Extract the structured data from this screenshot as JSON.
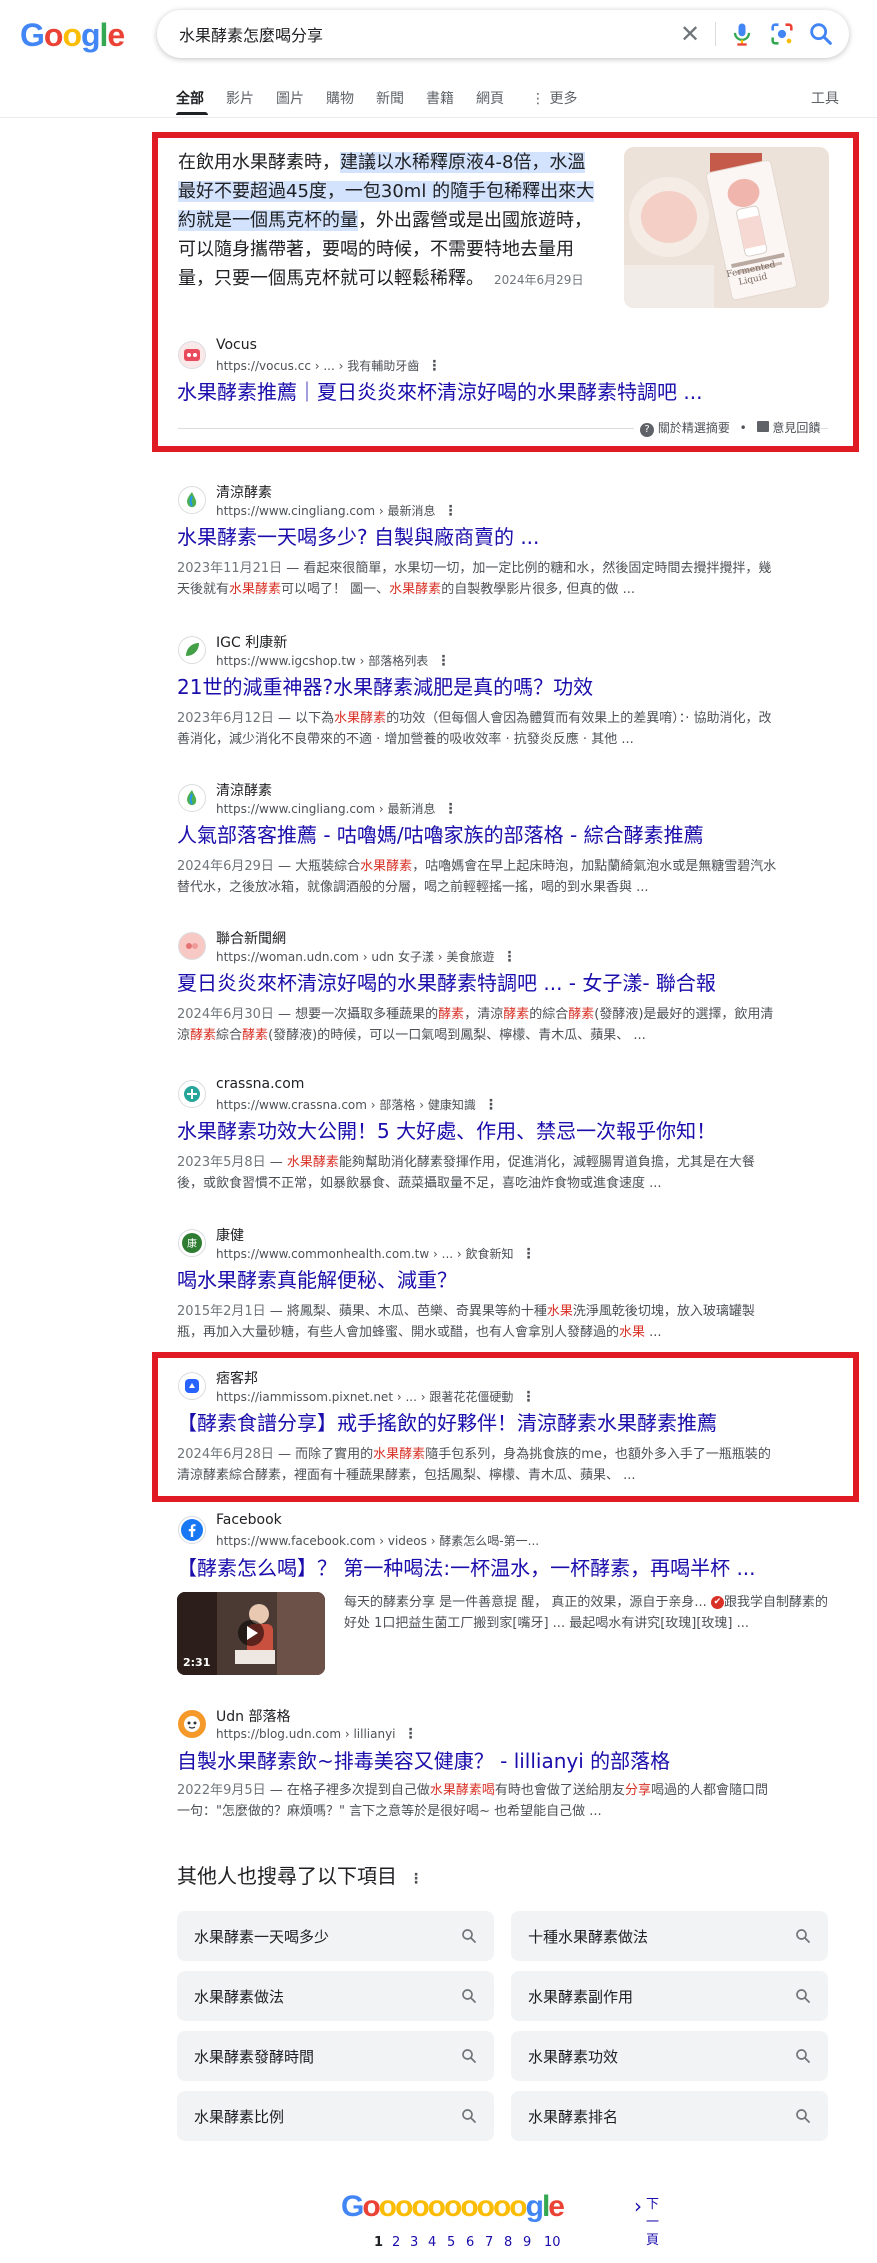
{
  "logo_text": "Google",
  "search": {
    "query": "水果酵素怎麼喝分享"
  },
  "tabs": [
    "全部",
    "影片",
    "圖片",
    "購物",
    "新聞",
    "書籍",
    "網頁",
    "更多"
  ],
  "tools_label": "工具",
  "featured": {
    "text_plain_1": "在飲用水果酵素時，",
    "text_hl": "建議以水稀釋原液4-8倍，水溫最好不要超過45度，一包30ml 的隨手包稀釋出來大約就是一個馬克杯的量",
    "text_plain_2": "，外出露營或是出國旅遊時，可以隨身攜帶著，要喝的時候，不需要特地去量用量，只要一個馬克杯就可以輕鬆稀釋。",
    "date": "2024年6月29日",
    "image_caption": "Fermented Liquid",
    "site": "Vocus",
    "url": "https://vocus.cc › ... › 我有輔助牙齒",
    "title": "水果酵素推薦｜夏日炎炎來杯清涼好喝的水果酵素特調吧 ...",
    "about_label": "關於精選摘要",
    "feedback_label": "意見回饋"
  },
  "results": [
    {
      "site": "清涼酵素",
      "url": "https://www.cingliang.com › 最新消息",
      "title": "水果酵素一天喝多少? 自製與廠商賣的 ...",
      "date": "2023年11月21日",
      "snippet_parts": [
        " — 看起來很簡單，水果切一切，加一定比例的糖和水，然後固定時間去攪拌攪拌，幾天後就有",
        "水果酵素",
        "可以喝了！ 圖一、",
        "水果酵素",
        "的自製教學影片很多, 但真的做 ..."
      ]
    },
    {
      "site": "IGC 利康新",
      "url": "https://www.igcshop.tw › 部落格列表",
      "title": "21世的減重神器?水果酵素減肥是真的嗎？功效",
      "date": "2023年6月12日",
      "snippet_parts": [
        " — 以下為",
        "水果酵素",
        "的功效（但每個人會因為體質而有效果上的差異唷）：· 協助消化，改善消化，減少消化不良帶來的不適 · 增加營養的吸收效率 · 抗發炎反應 · 其他 ..."
      ]
    },
    {
      "site": "清涼酵素",
      "url": "https://www.cingliang.com › 最新消息",
      "title": "人氣部落客推薦 - 咕嚕媽/咕嚕家族的部落格 - 綜合酵素推薦",
      "date": "2024年6月29日",
      "snippet_parts": [
        " — 大瓶裝綜合",
        "水果酵素",
        "，咕嚕媽會在早上起床時泡，加點蘭綺氣泡水或是無糖雪碧汽水替代水，之後放冰箱，就像調酒般的分層，喝之前輕輕搖一搖，喝的到水果香與 ..."
      ]
    },
    {
      "site": "聯合新聞網",
      "url": "https://woman.udn.com › udn 女子漾 › 美食旅遊",
      "title": "夏日炎炎來杯清涼好喝的水果酵素特調吧 ... - 女子漾- 聯合報",
      "date": "2024年6月30日",
      "snippet_parts": [
        " — 想要一次攝取多種蔬果的",
        "酵素",
        "，清涼",
        "酵素",
        "的綜合",
        "酵素",
        "(發酵液)是最好的選擇，飲用清涼",
        "酵素",
        "綜合",
        "酵素",
        "(發酵液)的時候，可以一口氣喝到鳳梨、檸檬、青木瓜、蘋果、 ..."
      ]
    },
    {
      "site": "crassna.com",
      "url": "https://www.crassna.com › 部落格 › 健康知識",
      "title": "水果酵素功效大公開！5 大好處、作用、禁忌一次報乎你知！",
      "date": "2023年5月8日",
      "snippet_parts": [
        " — ",
        "水果酵素",
        "能夠幫助消化酵素發揮作用，促進消化，減輕腸胃道負擔，尤其是在大餐後，或飲食習慣不正常，如暴飲暴食、蔬菜攝取量不足，喜吃油炸食物或進食速度 ..."
      ]
    },
    {
      "site": "康健",
      "url": "https://www.commonhealth.com.tw › ... › 飲食新知",
      "title": "喝水果酵素真能解便秘、減重？",
      "date": "2015年2月1日",
      "snippet_parts": [
        " — 將鳳梨、蘋果、木瓜、芭樂、奇異果等約十種",
        "水果",
        "洗淨風乾後切塊，放入玻璃罐製瓶，再加入大量砂糖，有些人會加蜂蜜、開水或醋，也有人會拿別人發酵過的",
        "水果",
        " ..."
      ]
    },
    {
      "site": "痞客邦",
      "url": "https://iammissom.pixnet.net › ... › 跟著花花僵硬動",
      "title": "【酵素食譜分享】戒手搖飲的好夥伴！清涼酵素水果酵素推薦",
      "date": "2024年6月28日",
      "snippet_parts": [
        " — 而除了實用的",
        "水果酵素",
        "隨手包系列，身為挑食族的me，也額外多入手了一瓶瓶裝的清涼酵素綜合酵素，裡面有十種蔬果酵素，包括鳳梨、檸檬、青木瓜、蘋果、 ..."
      ]
    }
  ],
  "video_result": {
    "site": "Facebook",
    "url": "https://www.facebook.com › videos › 酵素怎么喝-第一...",
    "title": "【酵素怎么喝】？ 第一种喝法:一杯温水，一杯酵素，再喝半杯 ...",
    "duration": "2:31",
    "snippet_parts": [
      "每天的酵素分享 是一件善意提 醒， 真正的效果，源自于亲身... ",
      "跟我学自制酵素的好处 1口把益生菌工厂搬到家[嘴牙] ... 最起喝水有讲究[玫瑰][玫瑰] ..."
    ]
  },
  "last_result": {
    "site": "Udn 部落格",
    "url": "https://blog.udn.com › lillianyi",
    "title": "自製水果酵素飲~排毒美容又健康？ - lillianyi 的部落格",
    "date": "2022年9月5日",
    "snippet_parts": [
      " — 在格子裡多次提到自己做",
      "水果酵素喝",
      "有時也會做了送給朋友",
      "分享",
      "喝過的人都會隨口問一句：\"怎麼做的？麻煩嗎？\" 言下之意等於是很好喝~ 也希望能自己做 ..."
    ]
  },
  "paa": {
    "title": "其他人也搜尋了以下項目",
    "items": [
      "水果酵素一天喝多少",
      "十種水果酵素做法",
      "水果酵素做法",
      "水果酵素副作用",
      "水果酵素發酵時間",
      "水果酵素功效",
      "水果酵素比例",
      "水果酵素排名"
    ]
  },
  "pager": {
    "logo": "Goooooooooogle",
    "pages": [
      "1",
      "2",
      "3",
      "4",
      "5",
      "6",
      "7",
      "8",
      "9",
      "10"
    ],
    "next_label": "下一頁"
  },
  "colors": {
    "link": "#1a0dab",
    "highlight": "#d3e3fd",
    "redbox": "#e01b24",
    "em": "#d93025"
  }
}
